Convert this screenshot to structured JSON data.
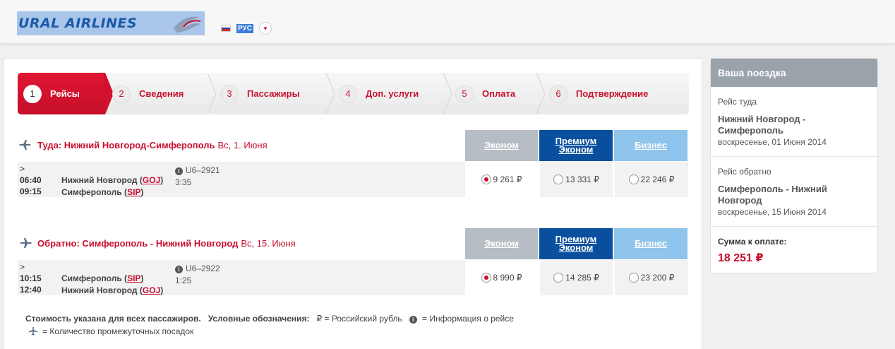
{
  "header": {
    "logo_text": "URAL AIRLINES",
    "language": "РУС"
  },
  "steps": [
    {
      "num": "1",
      "label": "Рейсы"
    },
    {
      "num": "2",
      "label": "Сведения"
    },
    {
      "num": "3",
      "label": "Пассажиры"
    },
    {
      "num": "4",
      "label": "Доп. услуги"
    },
    {
      "num": "5",
      "label": "Оплата"
    },
    {
      "num": "6",
      "label": "Подтверждение"
    }
  ],
  "fare_headers": {
    "economy": "Эконом",
    "premium_1": "Премиум",
    "premium_2": "Эконом",
    "business": "Бизнес"
  },
  "outbound": {
    "title_bold": "Туда: Нижний Новгород-Симферополь",
    "title_date": "Вс, 1. Июня",
    "arrow": ">",
    "dep_time": "06:40",
    "arr_time": "09:15",
    "dep_city": "Нижний Новгород",
    "dep_code": "GOJ",
    "arr_city": "Симферополь",
    "arr_code": "SIP",
    "flight_no": "U6–2921",
    "duration": "3:35",
    "price_economy": "9 261 ₽",
    "price_premium": "13 331 ₽",
    "price_business": "22 246 ₽"
  },
  "return": {
    "title_bold": "Обратно: Симферополь - Нижний Новгород",
    "title_date": "Вс, 15. Июня",
    "arrow": ">",
    "dep_time": "10:15",
    "arr_time": "12:40",
    "dep_city": "Симферополь",
    "dep_code": "SIP",
    "arr_city": "Нижний Новгород",
    "arr_code": "GOJ",
    "flight_no": "U6–2922",
    "duration": "1:25",
    "price_economy": "8 990 ₽",
    "price_premium": "14 285 ₽",
    "price_business": "23 200 ₽"
  },
  "legend": {
    "note": "Стоимость указана для всех пассажиров.",
    "title": "Условные обозначения:",
    "ruble_symbol": "₽",
    "ruble": "= Российский рубль",
    "info": "= Информация о рейсе",
    "stops": "= Количество промежуточных посадок"
  },
  "sidebar": {
    "title": "Ваша поездка",
    "out_label": "Рейс туда",
    "out_route": "Нижний Новгород - Симферополь",
    "out_date": "воскресенье, 01 Июня 2014",
    "ret_label": "Рейс обратно",
    "ret_route": "Симферополь - Нижний Новгород",
    "ret_date": "воскресенье, 15 Июня 2014",
    "sum_label": "Сумма к оплате:",
    "sum": "18 251 ₽"
  },
  "colors": {
    "brand_red": "#c8102e",
    "premium_blue": "#0a4f9e",
    "business_blue": "#8fc4ec",
    "economy_grey": "#b7bdc4"
  }
}
